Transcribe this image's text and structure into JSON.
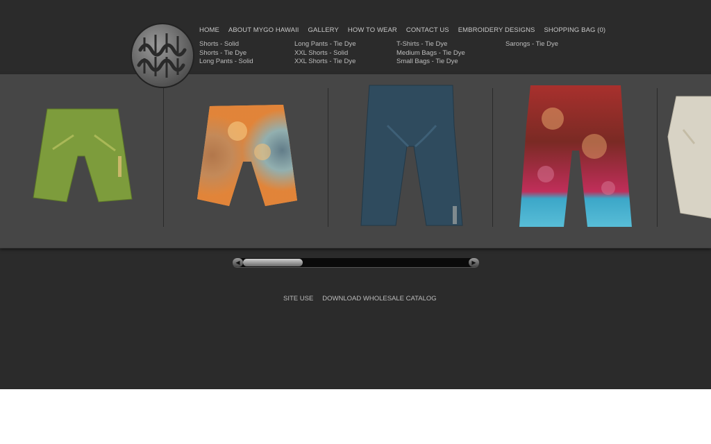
{
  "brand": {
    "logo_alt": "MYGO HAWAII"
  },
  "nav": {
    "items": [
      "HOME",
      "ABOUT MYGO HAWAII",
      "GALLERY",
      "HOW TO WEAR",
      "CONTACT US",
      "EMBROIDERY DESIGNS",
      "SHOPPING BAG (0)"
    ]
  },
  "submenu": {
    "col1": [
      "Shorts - Solid",
      "Shorts - Tie Dye",
      "Long Pants - Solid"
    ],
    "col2": [
      "Long Pants - Tie Dye",
      "XXL Shorts - Solid",
      "XXL Shorts - Tie Dye"
    ],
    "col3": [
      "T-Shirts - Tie Dye",
      "Medium Bags - Tie Dye",
      "Small Bags - Tie Dye"
    ],
    "col4": [
      "Sarongs - Tie Dye"
    ]
  },
  "gallery": {
    "products": [
      {
        "name": "green-shorts",
        "color": "#7a9a3a"
      },
      {
        "name": "tie-dye-orange-shorts",
        "color": "#e0762a"
      },
      {
        "name": "blue-long-pants",
        "color": "#2f4a5c"
      },
      {
        "name": "tie-dye-red-long-pants",
        "color": "#a02a3a"
      },
      {
        "name": "beige-pants",
        "color": "#d7d2c4"
      }
    ]
  },
  "scrollbar": {
    "left_arrow": "◀",
    "right_arrow": "▶",
    "position_fraction": 0.05
  },
  "footer": {
    "links": [
      "SITE USE",
      "DOWNLOAD WHOLESALE CATALOG"
    ]
  },
  "colors": {
    "background": "#2b2b2b",
    "band": "#464646",
    "text": "#c8c8c8"
  }
}
